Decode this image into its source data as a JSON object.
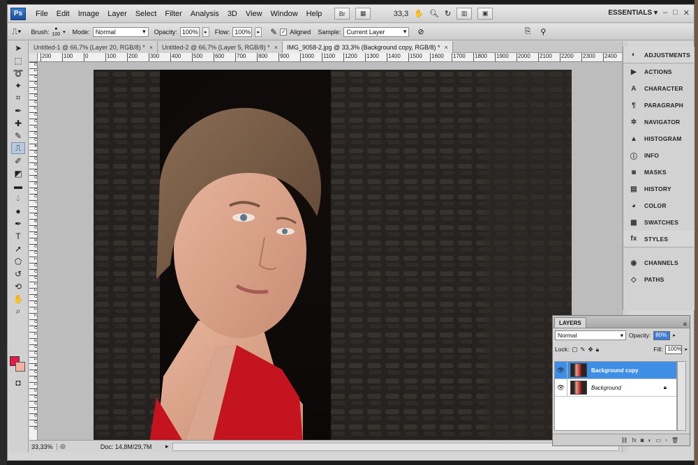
{
  "app": {
    "logo": "Ps"
  },
  "menu": [
    "File",
    "Edit",
    "Image",
    "Layer",
    "Select",
    "Filter",
    "Analysis",
    "3D",
    "View",
    "Window",
    "Help"
  ],
  "menubar": {
    "bridge_label": "Br",
    "zoom": "33,3",
    "workspace": "ESSENTIALS",
    "win_controls": [
      "–",
      "□",
      "✕"
    ]
  },
  "options": {
    "brush_label": "Brush:",
    "brush_size": "100",
    "mode_label": "Mode:",
    "mode_value": "Normal",
    "opacity_label": "Opacity:",
    "opacity_value": "100%",
    "flow_label": "Flow:",
    "flow_value": "100%",
    "aligned_label": "Aligned",
    "aligned_checked": true,
    "sample_label": "Sample:",
    "sample_value": "Current Layer"
  },
  "tabs": [
    {
      "label": "Untitled-1 @ 66,7% (Layer 20, RGB/8) *",
      "close": "×"
    },
    {
      "label": "Untitled-2 @ 66,7% (Layer 5, RGB/8) *",
      "close": "×"
    },
    {
      "label": "IMG_9058-2.jpg @ 33,3% (Background copy, RGB/8) *",
      "close": "×"
    }
  ],
  "ruler_h": [
    "200",
    "100",
    "0",
    "100",
    "200",
    "300",
    "400",
    "500",
    "600",
    "700",
    "800",
    "900",
    "1000",
    "1100",
    "1200",
    "1300",
    "1400",
    "1500",
    "1600",
    "1700",
    "1800",
    "1900",
    "2000",
    "2100",
    "2200",
    "2300",
    "2400",
    "2500"
  ],
  "ruler_v": [
    "0",
    "1",
    "0",
    "0",
    "1",
    "0",
    "0",
    "2",
    "0",
    "0",
    "3",
    "0",
    "0",
    "4",
    "0",
    "0",
    "5",
    "0",
    "0",
    "6",
    "0",
    "0",
    "7",
    "0",
    "0",
    "8",
    "0",
    "0",
    "9",
    "0",
    "0",
    "1",
    "0",
    "0",
    "0",
    "1",
    "1",
    "0",
    "0",
    "1",
    "2",
    "0",
    "0",
    "1",
    "3",
    "0",
    "0",
    "1",
    "4",
    "0",
    "0",
    "1",
    "5",
    "0",
    "0",
    "1",
    "6",
    "0",
    "0"
  ],
  "status": {
    "zoom": "33,33%",
    "doc": "Doc: 14,8M/29,7M"
  },
  "panels": [
    {
      "label": "ADJUSTMENTS",
      "icon": "adjustments-icon",
      "glyph": "◐"
    },
    {
      "label": "ACTIONS",
      "icon": "actions-icon",
      "glyph": "▶"
    },
    {
      "label": "CHARACTER",
      "icon": "character-icon",
      "glyph": "A"
    },
    {
      "label": "PARAGRAPH",
      "icon": "paragraph-icon",
      "glyph": "¶"
    },
    {
      "label": "NAVIGATOR",
      "icon": "navigator-icon",
      "glyph": "✲"
    },
    {
      "label": "HISTOGRAM",
      "icon": "histogram-icon",
      "glyph": "▲"
    },
    {
      "label": "INFO",
      "icon": "info-icon",
      "glyph": "ⓘ"
    },
    {
      "label": "MASKS",
      "icon": "masks-icon",
      "glyph": "◙"
    },
    {
      "label": "HISTORY",
      "icon": "history-icon",
      "glyph": "▤"
    },
    {
      "label": "COLOR",
      "icon": "color-icon",
      "glyph": "◕"
    },
    {
      "label": "SWATCHES",
      "icon": "swatches-icon",
      "glyph": "▦"
    },
    {
      "label": "STYLES",
      "icon": "styles-icon",
      "glyph": "fx"
    },
    {
      "label": "CHANNELS",
      "icon": "channels-icon",
      "glyph": "◉"
    },
    {
      "label": "PATHS",
      "icon": "paths-icon",
      "glyph": "◇"
    }
  ],
  "layers": {
    "tab": "LAYERS",
    "blend": "Normal",
    "opacity_label": "Opacity:",
    "opacity_value": "80%",
    "lock_label": "Lock:",
    "fill_label": "Fill:",
    "fill_value": "100%",
    "items": [
      {
        "name": "Background copy",
        "selected": true
      },
      {
        "name": "Background",
        "selected": false,
        "locked": true
      }
    ]
  },
  "colors": {
    "foreground": "#e8184b",
    "background": "#f3b3a0",
    "selection": "#3f8ee6"
  }
}
